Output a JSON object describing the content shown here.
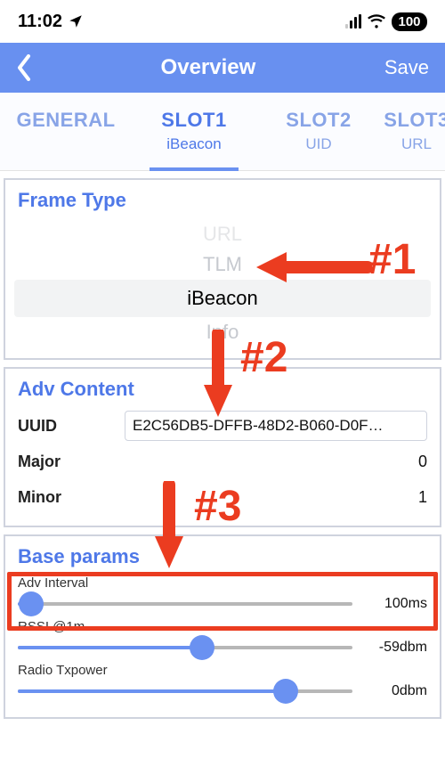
{
  "status": {
    "time": "11:02",
    "battery": "100"
  },
  "nav": {
    "title": "Overview",
    "save": "Save"
  },
  "tabs": [
    {
      "t1": "GENERAL",
      "t2": ""
    },
    {
      "t1": "SLOT1",
      "t2": "iBeacon"
    },
    {
      "t1": "SLOT2",
      "t2": "UID"
    },
    {
      "t1": "SLOT3",
      "t2": "URL"
    }
  ],
  "frame": {
    "title": "Frame Type",
    "opts": [
      "URL",
      "TLM",
      "iBeacon",
      "Info"
    ],
    "selected": "iBeacon"
  },
  "adv": {
    "title": "Adv Content",
    "uuid_label": "UUID",
    "uuid": "E2C56DB5-DFFB-48D2-B060-D0F…",
    "major_label": "Major",
    "major": "0",
    "minor_label": "Minor",
    "minor": "1"
  },
  "base": {
    "title": "Base params",
    "interval_label": "Adv Interval",
    "interval_value": "100ms",
    "rssi_label": "RSSI @1m",
    "rssi_value": "-59dbm",
    "tx_label": "Radio Txpower",
    "tx_value": "0dbm"
  },
  "annotations": {
    "n1": "#1",
    "n2": "#2",
    "n3": "#3"
  }
}
